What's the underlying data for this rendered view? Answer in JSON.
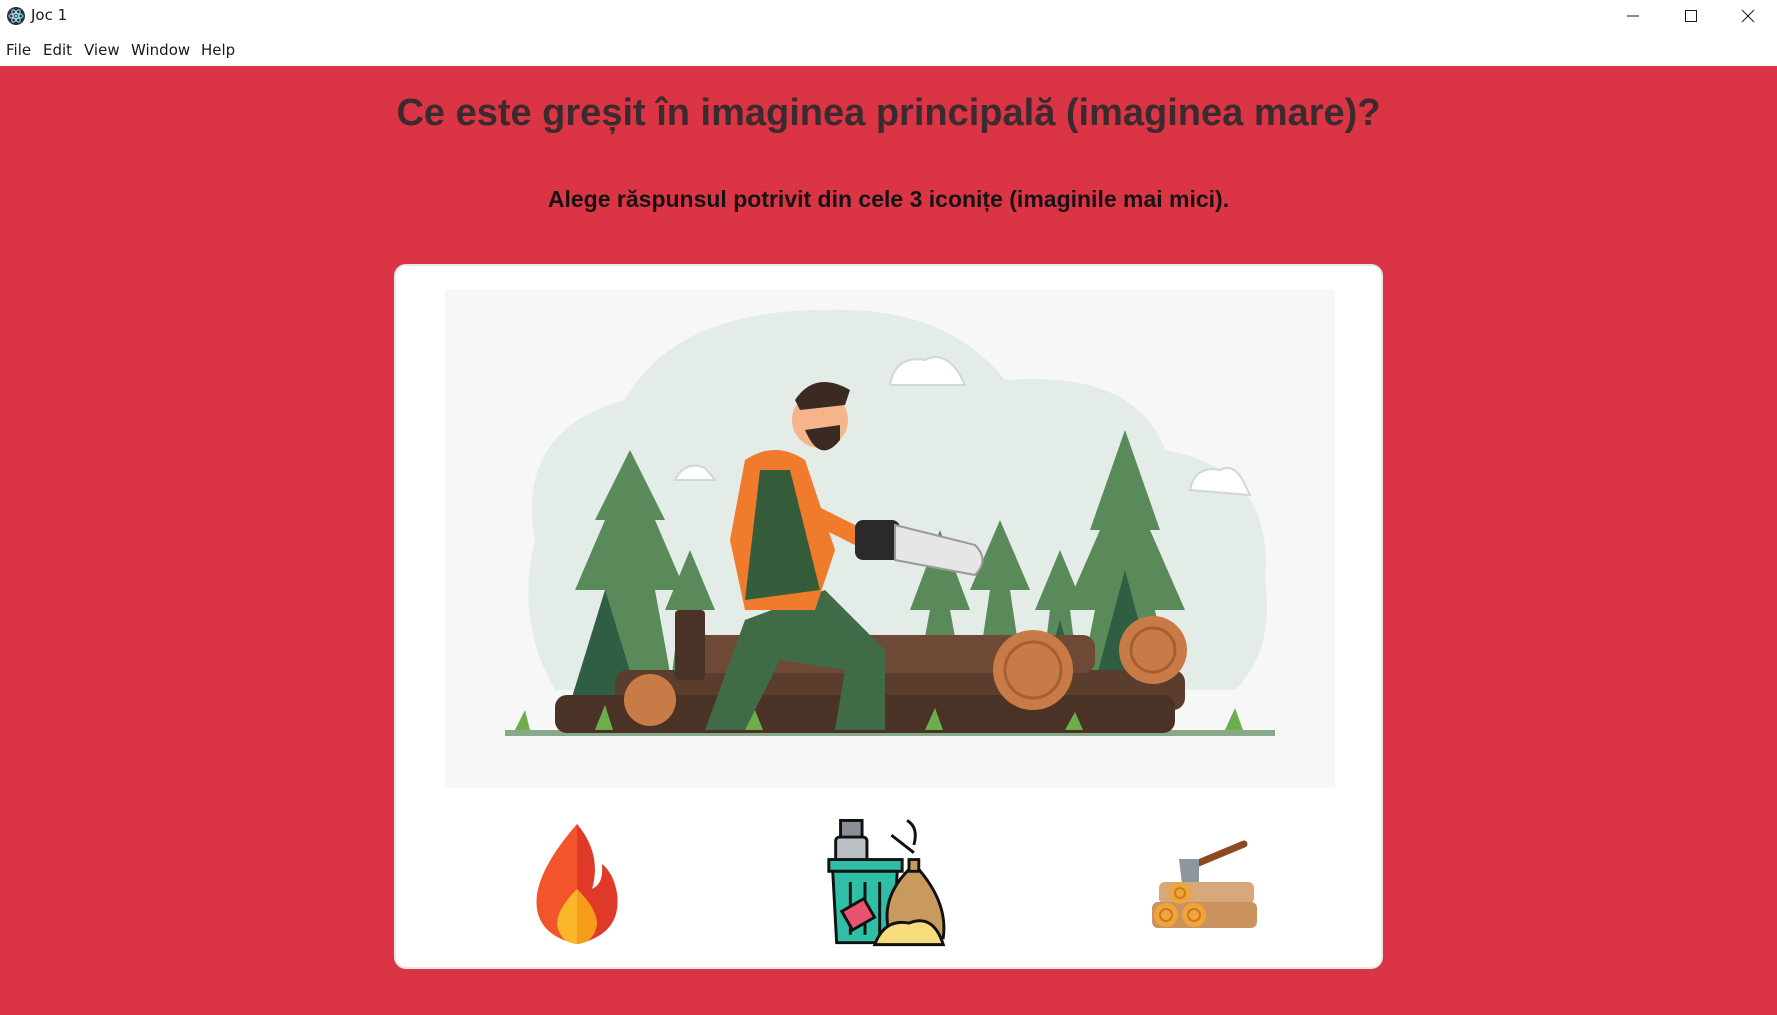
{
  "window": {
    "title": "Joc 1",
    "app_icon": "electron-icon",
    "controls": [
      "minimize-icon",
      "maximize-icon",
      "close-icon"
    ]
  },
  "menu": {
    "items": [
      "File",
      "Edit",
      "View",
      "Window",
      "Help"
    ]
  },
  "quiz": {
    "question": "Ce este greșit în imaginea principală (imaginea mare)?",
    "instruction": "Alege răspunsul potrivit din cele 3 iconițe (imaginile mai mici).",
    "main_image": "lumberjack-cutting-logs-illustration",
    "options": [
      {
        "icon": "fire-icon"
      },
      {
        "icon": "garbage-bin-icon"
      },
      {
        "icon": "axe-firewood-icon"
      }
    ]
  },
  "colors": {
    "background": "#db3445",
    "heading": "#3a2b2e",
    "card": "#ffffff"
  }
}
